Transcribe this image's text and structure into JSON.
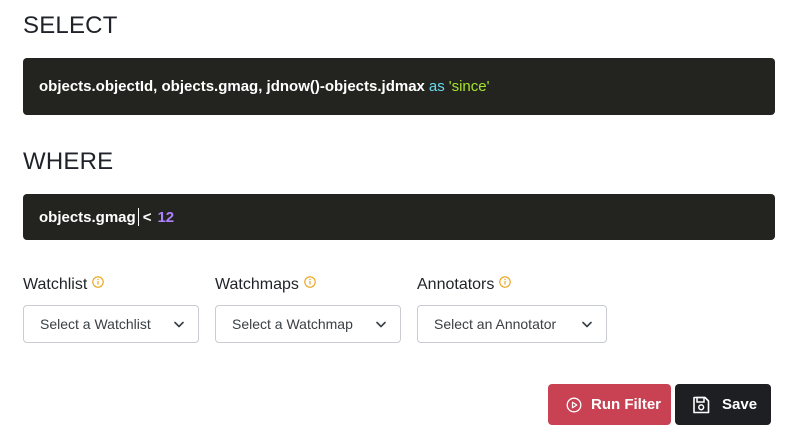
{
  "select_section": {
    "title": "SELECT",
    "code": {
      "main": "objects.objectId,  objects.gmag,  jdnow()-objects.jdmax",
      "keyword": "as",
      "alias": "'since'"
    }
  },
  "where_section": {
    "title": "WHERE",
    "code": {
      "field": "objects.gmag",
      "operator": "<",
      "value": "12"
    }
  },
  "filters": {
    "watchlist": {
      "label": "Watchlist",
      "placeholder": "Select a Watchlist",
      "info_icon": "info-circle-icon"
    },
    "watchmaps": {
      "label": "Watchmaps",
      "placeholder": "Select a Watchmap",
      "info_icon": "info-circle-icon"
    },
    "annotators": {
      "label": "Annotators",
      "placeholder": "Select an Annotator",
      "info_icon": "info-circle-icon"
    }
  },
  "actions": {
    "run_filter": {
      "label": "Run Filter",
      "icon": "play-circle-icon",
      "color": "#c94254"
    },
    "save": {
      "label": "Save",
      "icon": "floppy-disk-icon",
      "color": "#1e1f22"
    }
  },
  "colors": {
    "code_background": "#23241f",
    "keyword": "#66d9ef",
    "string": "#a6e22e",
    "number": "#ae81ff",
    "info_icon": "#e8a317"
  }
}
